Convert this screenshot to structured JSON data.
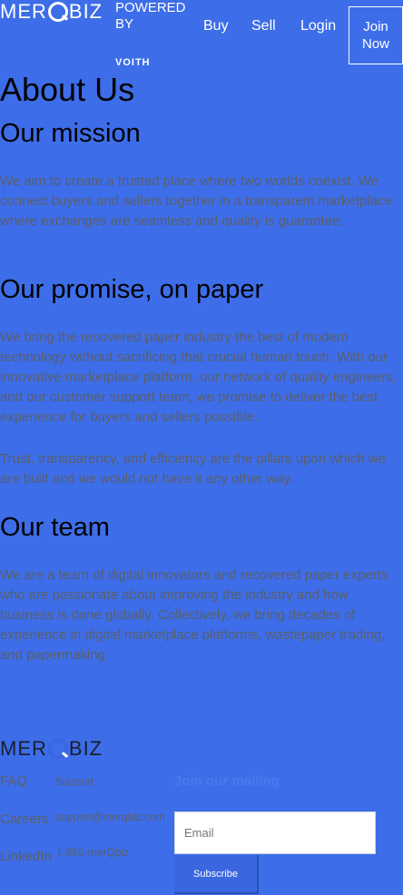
{
  "header": {
    "logo_text_left": "MER",
    "logo_text_right": "BIZ",
    "powered_by": "POWERED BY",
    "voith": "VOITH",
    "nav": {
      "buy": "Buy",
      "sell": "Sell",
      "login": "Login",
      "join_now": "Join Now"
    }
  },
  "main": {
    "title": "About Us",
    "mission": {
      "heading": "Our mission",
      "text": "We aim to create a trusted place where two worlds coexist. We connect buyers and sellers together in a transparent marketplace where exchanges are seamless and quality is guarantee."
    },
    "promise": {
      "heading": "Our promise, on paper",
      "text1": "We bring the recovered paper industry the best of modern technology without sacrificing that crucial human touch. With our innovative marketplace platform, our network of quality engineers, and our customer support team, we promise to deliver the best experience for buyers and sellers possible.",
      "text2": "Trust, transparency, and efficiency are the pillars upon which we are built and we would not have it any other way."
    },
    "team": {
      "heading": "Our team",
      "text": "We are a team of digital innovators and recovered paper experts who are passionate about improving the industry and how business is done globally. Collectively, we bring decades of experience in digital marketplace platforms, wastepaper trading, and papermaking."
    }
  },
  "footer": {
    "logo_text_left": "MER",
    "logo_text_right": "BIZ",
    "links": {
      "faq": "FAQ",
      "careers": "Careers",
      "linkedin": "LinkedIn"
    },
    "support": {
      "label": "Support",
      "email": "support@merqbiz.com",
      "phone": "1-855-merQbiz"
    },
    "mailing": {
      "heading": "Join our mailing",
      "email_placeholder": "Email",
      "subscribe": "Subscribe"
    }
  },
  "colors": {
    "background": "#3d6de8",
    "text_dark": "#000000",
    "text_muted": "#5b5f66",
    "accent": "#3a66e0"
  }
}
